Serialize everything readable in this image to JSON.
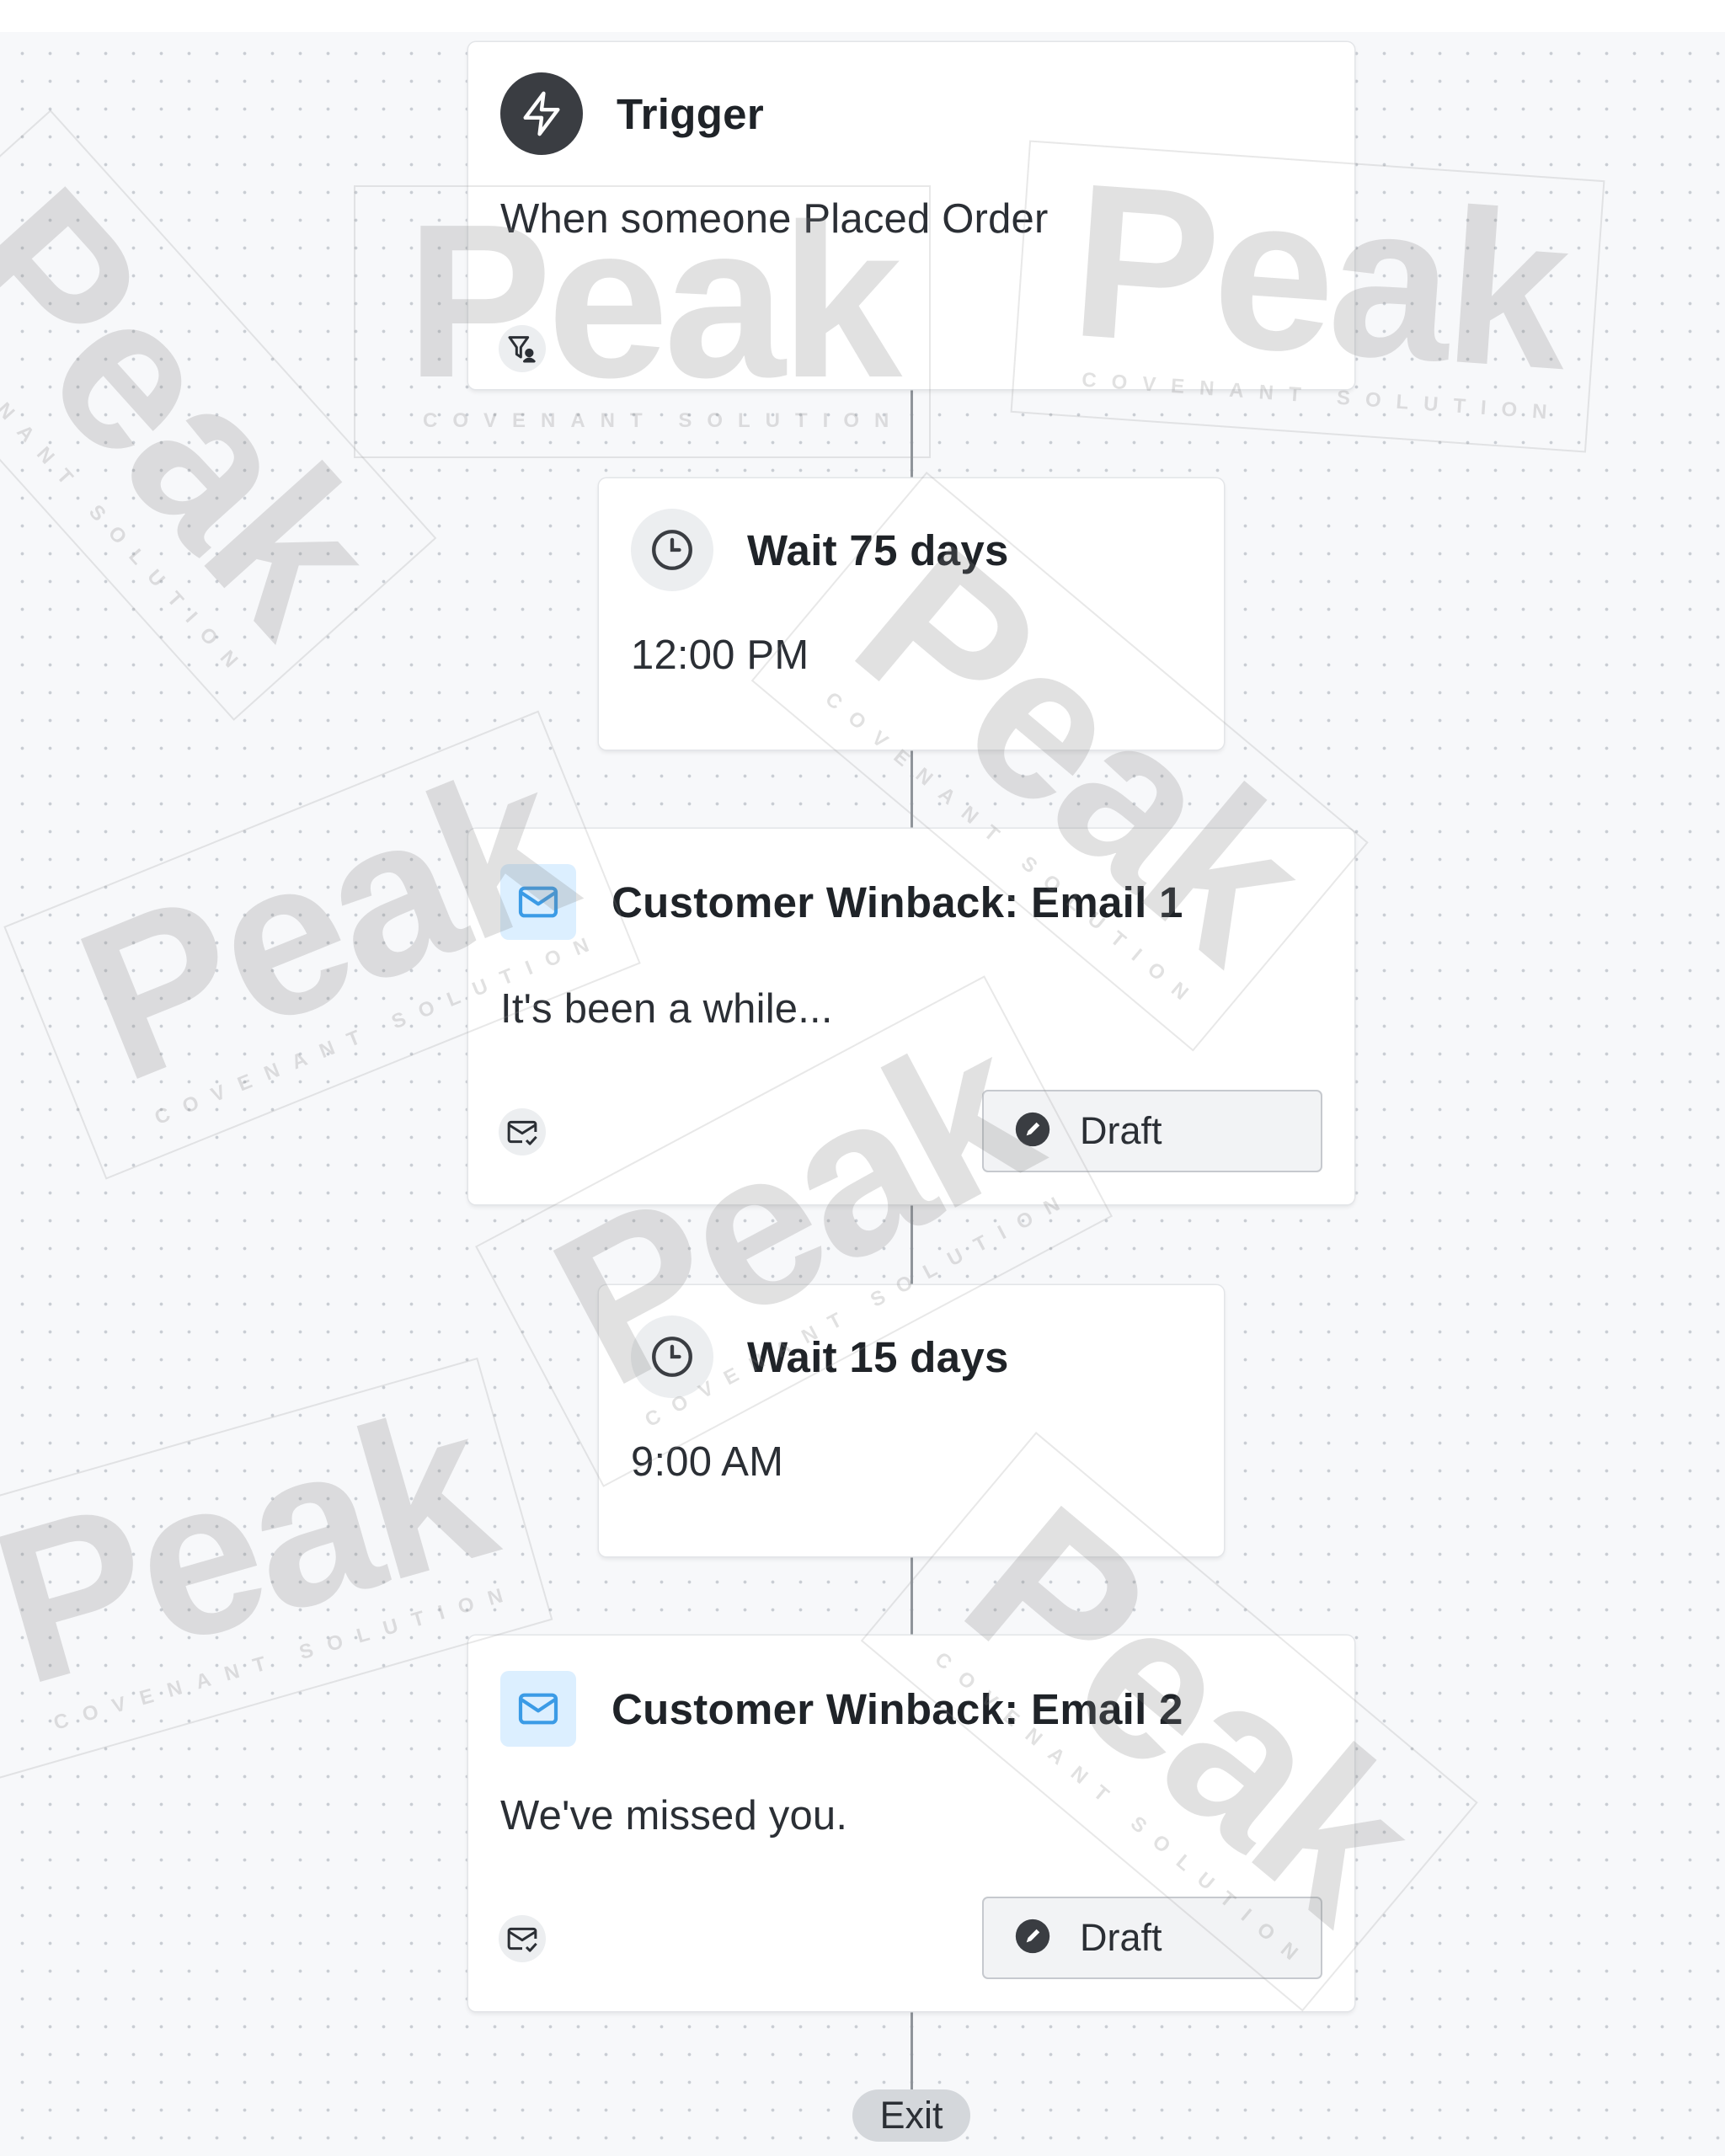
{
  "flow": {
    "trigger": {
      "title": "Trigger",
      "description": "When someone Placed Order",
      "icon": "lightning-icon",
      "filter_icon": "filter-user-icon"
    },
    "wait_1": {
      "title": "Wait 75 days",
      "time": "12:00 PM",
      "icon": "clock-icon"
    },
    "email_1": {
      "title": "Customer Winback: Email 1",
      "subject": "It's been a while...",
      "status": "Draft",
      "icon": "mail-icon",
      "status_icon": "pencil-icon"
    },
    "wait_2": {
      "title": "Wait 15 days",
      "time": "9:00 AM",
      "icon": "clock-icon"
    },
    "email_2": {
      "title": "Customer Winback: Email 2",
      "subject": "We've missed you.",
      "status": "Draft",
      "icon": "mail-icon",
      "status_icon": "pencil-icon"
    },
    "exit": {
      "label": "Exit"
    }
  },
  "watermark": {
    "brand": "Peak",
    "tagline": "COVENANT SOLUTION"
  },
  "colors": {
    "canvas": "#f7f8fa",
    "dot": "#c9cdd3",
    "connector": "#8f949a",
    "email_icon_bg": "#dcefff",
    "email_icon": "#3b9be6",
    "trigger_icon_bg": "#3a3d42"
  }
}
